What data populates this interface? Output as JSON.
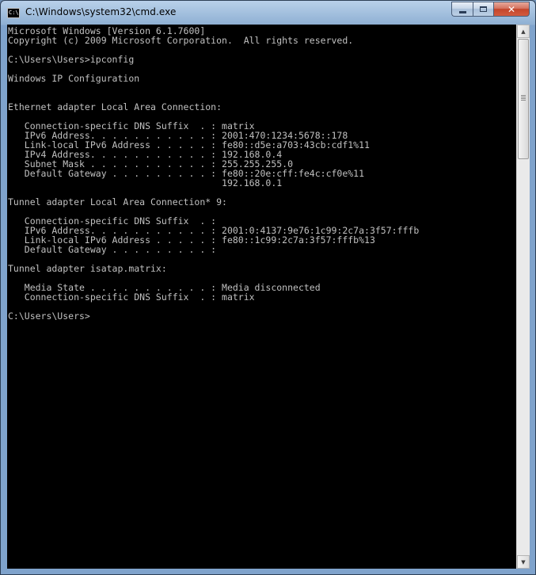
{
  "window": {
    "title": "C:\\Windows\\system32\\cmd.exe",
    "icon": "cmd-console-icon",
    "icon_glyph": "C:\\"
  },
  "caption": {
    "close_label": "✕"
  },
  "console": {
    "lines": [
      "Microsoft Windows [Version 6.1.7600]",
      "Copyright (c) 2009 Microsoft Corporation.  All rights reserved.",
      "",
      "C:\\Users\\Users>ipconfig",
      "",
      "Windows IP Configuration",
      "",
      "",
      "Ethernet adapter Local Area Connection:",
      "",
      "   Connection-specific DNS Suffix  . : matrix",
      "   IPv6 Address. . . . . . . . . . . : 2001:470:1234:5678::178",
      "   Link-local IPv6 Address . . . . . : fe80::d5e:a703:43cb:cdf1%11",
      "   IPv4 Address. . . . . . . . . . . : 192.168.0.4",
      "   Subnet Mask . . . . . . . . . . . : 255.255.255.0",
      "   Default Gateway . . . . . . . . . : fe80::20e:cff:fe4c:cf0e%11",
      "                                       192.168.0.1",
      "",
      "Tunnel adapter Local Area Connection* 9:",
      "",
      "   Connection-specific DNS Suffix  . :",
      "   IPv6 Address. . . . . . . . . . . : 2001:0:4137:9e76:1c99:2c7a:3f57:fffb",
      "   Link-local IPv6 Address . . . . . : fe80::1c99:2c7a:3f57:fffb%13",
      "   Default Gateway . . . . . . . . . :",
      "",
      "Tunnel adapter isatap.matrix:",
      "",
      "   Media State . . . . . . . . . . . : Media disconnected",
      "   Connection-specific DNS Suffix  . : matrix",
      "",
      "C:\\Users\\Users>"
    ]
  },
  "colors": {
    "console_bg": "#000000",
    "console_fg": "#c0c0c0"
  }
}
